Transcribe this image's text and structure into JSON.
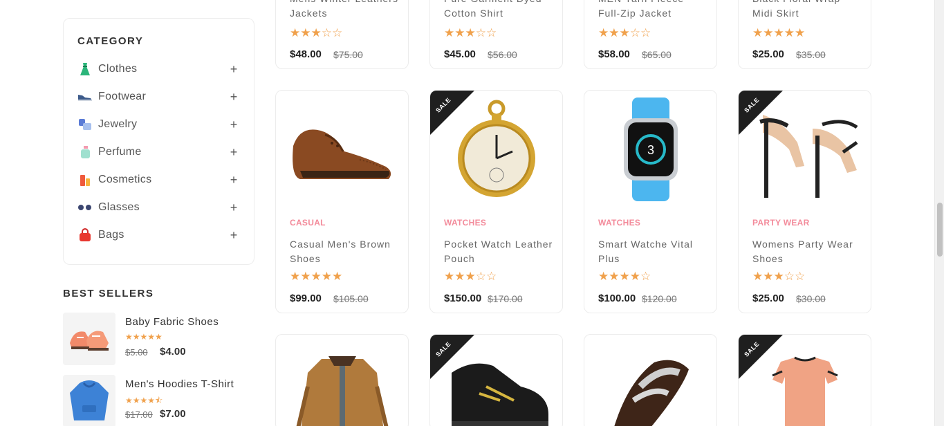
{
  "sidebar": {
    "category_title": "CATEGORY",
    "categories": [
      {
        "label": "Clothes",
        "icon": "dress-icon"
      },
      {
        "label": "Footwear",
        "icon": "shoe-icon"
      },
      {
        "label": "Jewelry",
        "icon": "jewelry-icon"
      },
      {
        "label": "Perfume",
        "icon": "perfume-icon"
      },
      {
        "label": "Cosmetics",
        "icon": "cosmetics-icon"
      },
      {
        "label": "Glasses",
        "icon": "glasses-icon"
      },
      {
        "label": "Bags",
        "icon": "bag-icon"
      }
    ],
    "expand_symbol": "+",
    "best_sellers_title": "BEST SELLERS",
    "best_sellers": [
      {
        "name": "Baby Fabric Shoes",
        "stars": "★★★★★",
        "rating": 5,
        "old_price": "$5.00",
        "price": "$4.00"
      },
      {
        "name": "Men's Hoodies T-Shirt",
        "stars": "★★★★⯪",
        "rating": 4.5,
        "old_price": "$17.00",
        "price": "$7.00"
      }
    ]
  },
  "products_top": [
    {
      "title": "Mens Winter Leathers Jackets",
      "stars": "★★★☆☆",
      "rating": 3,
      "price": "$48.00",
      "old_price": "$75.00"
    },
    {
      "title": "Pure Garment Dyed Cotton Shirt",
      "stars": "★★★☆☆",
      "rating": 3,
      "price": "$45.00",
      "old_price": "$56.00"
    },
    {
      "title": "MEN Yarn Fleece Full-Zip Jacket",
      "stars": "★★★☆☆",
      "rating": 3,
      "price": "$58.00",
      "old_price": "$65.00"
    },
    {
      "title": "Black Floral Wrap Midi Skirt",
      "stars": "★★★★★",
      "rating": 5,
      "price": "$25.00",
      "old_price": "$35.00"
    }
  ],
  "products": [
    {
      "category": "CASUAL",
      "title": "Casual Men's Brown Shoes",
      "stars": "★★★★★",
      "rating": 5,
      "price": "$99.00",
      "old_price": "$105.00",
      "sale": false,
      "image": "brown-shoe"
    },
    {
      "category": "WATCHES",
      "title": "Pocket Watch Leather Pouch",
      "stars": "★★★☆☆",
      "rating": 3,
      "price": "$150.00",
      "old_price": "$170.00",
      "sale": true,
      "image": "pocket-watch"
    },
    {
      "category": "WATCHES",
      "title": "Smart Watche Vital Plus",
      "stars": "★★★★☆",
      "rating": 4,
      "price": "$100.00",
      "old_price": "$120.00",
      "sale": false,
      "image": "smart-watch"
    },
    {
      "category": "PARTY WEAR",
      "title": "Womens Party Wear Shoes",
      "stars": "★★★☆☆",
      "rating": 3,
      "price": "$25.00",
      "old_price": "$30.00",
      "sale": true,
      "image": "heels"
    }
  ],
  "products_bottom": [
    {
      "sale": false,
      "image": "jacket"
    },
    {
      "sale": true,
      "image": "sneaker"
    },
    {
      "sale": false,
      "image": "dress-shoe"
    },
    {
      "sale": true,
      "image": "tshirt-set"
    }
  ],
  "sale_label": "SALE",
  "watch_display": "3"
}
